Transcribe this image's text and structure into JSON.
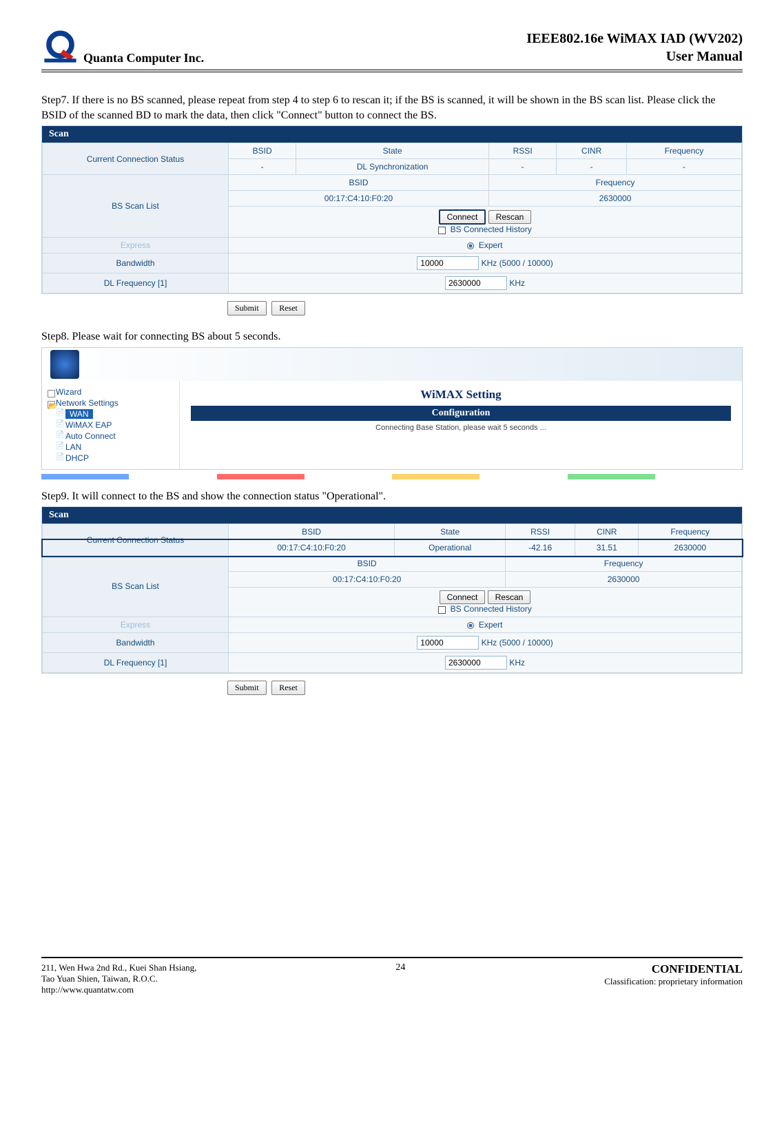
{
  "header": {
    "company": "Quanta  Computer  Inc.",
    "title_line1": "IEEE802.16e  WiMAX  IAD  (WV202)",
    "title_line2": "User  Manual"
  },
  "step7_text": "Step7. If there is no BS scanned, please repeat from step 4 to step 6 to rescan it; if the BS is scanned, it will be shown in the BS scan list. Please click the BSID of the scanned BD to mark the data, then click \"Connect\" button to connect the BS.",
  "scan1": {
    "title": "Scan",
    "labels": {
      "ccs": "Current Connection Status",
      "bslist": "BS Scan List",
      "express": "Express",
      "bandwidth": "Bandwidth",
      "dlfreq": "DL Frequency [1]"
    },
    "cols": {
      "bsid": "BSID",
      "state": "State",
      "rssi": "RSSI",
      "cinr": "CINR",
      "freq": "Frequency"
    },
    "row": {
      "bsid": "-",
      "state": "DL Synchronization",
      "rssi": "-",
      "cinr": "-",
      "freq": "-"
    },
    "listcols": {
      "bsid": "BSID",
      "freq": "Frequency"
    },
    "listrow": {
      "bsid": "00:17:C4:10:F0:20",
      "freq": "2630000"
    },
    "buttons": {
      "connect": "Connect",
      "rescan": "Rescan",
      "history": "BS Connected History",
      "submit": "Submit",
      "reset": "Reset"
    },
    "expert": "Expert",
    "bandwidth_val": "10000",
    "bandwidth_unit": "KHz (5000 / 10000)",
    "dlfreq_val": "2630000",
    "dlfreq_unit": "KHz"
  },
  "step8_text": "Step8. Please wait for connecting BS about 5 seconds.",
  "nav": {
    "wizard": "Wizard",
    "network": "Network Settings",
    "wan": "WAN",
    "wimax_eap": "WiMAX EAP",
    "auto_connect": "Auto Connect",
    "lan": "LAN",
    "dhcp": "DHCP",
    "right_title": "WiMAX Setting",
    "conf": "Configuration",
    "msg": "Connecting Base Station, please wait  5  seconds ..."
  },
  "step9_text": "Step9. It will connect to the BS and show the connection status \"Operational\".",
  "scan2": {
    "row": {
      "bsid": "00:17:C4:10:F0:20",
      "state": "Operational",
      "rssi": "-42.16",
      "cinr": "31.51",
      "freq": "2630000"
    }
  },
  "footer": {
    "addr1": "211, Wen Hwa 2nd Rd., Kuei Shan Hsiang,",
    "addr2": "Tao Yuan Shien, Taiwan, R.O.C.",
    "addr3": "http://www.quantatw.com",
    "page": "24",
    "conf": "CONFIDENTIAL",
    "class": "Classification: proprietary information"
  }
}
